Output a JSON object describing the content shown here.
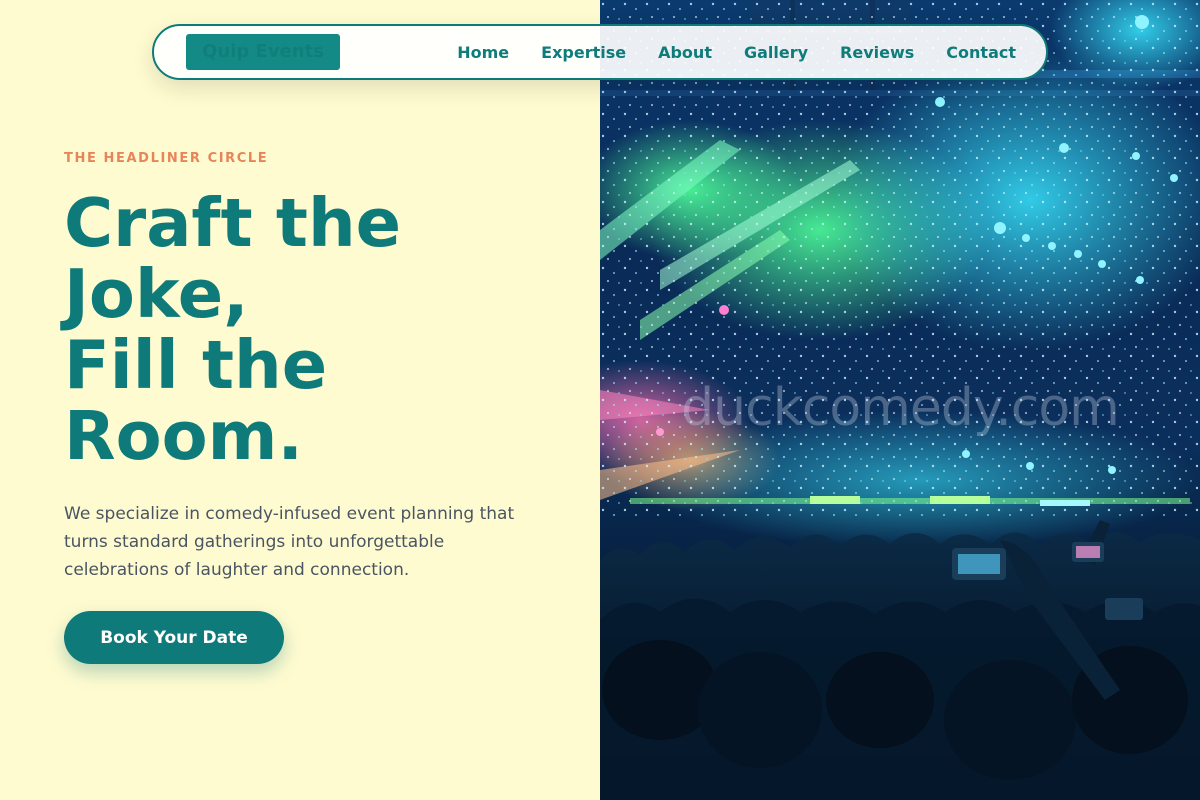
{
  "brand": {
    "logo_text": "Quip Events"
  },
  "nav": {
    "items": [
      {
        "label": "Home"
      },
      {
        "label": "Expertise"
      },
      {
        "label": "About"
      },
      {
        "label": "Gallery"
      },
      {
        "label": "Reviews"
      },
      {
        "label": "Contact"
      }
    ]
  },
  "hero": {
    "eyebrow": "THE HEADLINER CIRCLE",
    "headline_lines": [
      "Craft the",
      "Joke,",
      "Fill the",
      "Room."
    ],
    "description": "We specialize in comedy-infused event planning that turns standard gatherings into unforgettable celebrations of laughter and connection.",
    "cta_label": "Book Your Date"
  },
  "photo": {
    "watermark": "duckcomedy.com"
  },
  "colors": {
    "accent": "#0f7a7a",
    "eyebrow": "#e8845a",
    "background": "#fffbd0",
    "body_text": "#4a5563"
  }
}
